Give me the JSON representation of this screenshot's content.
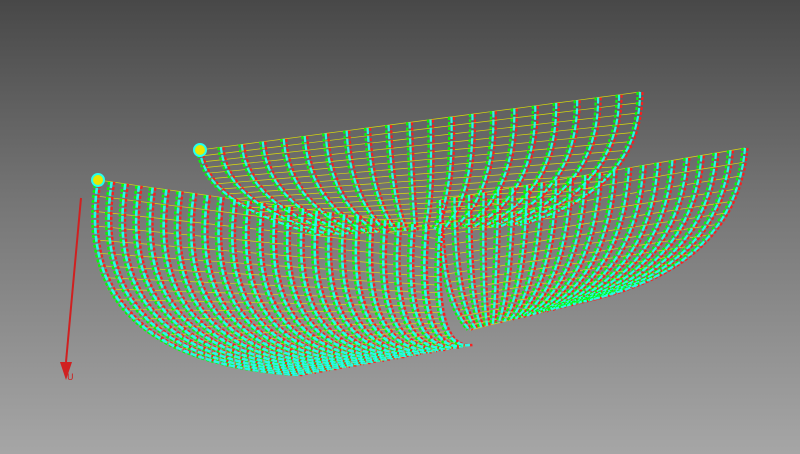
{
  "viewport": {
    "background_top": "#484848",
    "background_bottom": "#a6a6a6"
  },
  "axis": {
    "label": "U",
    "color": "#d02020"
  },
  "mesh": {
    "line_color": "#e8e800",
    "rib_colors": [
      "#00ff00",
      "#ff1a1a",
      "#22ffee"
    ],
    "description_colors": {
      "stringers": "yellow",
      "ribs": "green/red/cyan"
    }
  }
}
